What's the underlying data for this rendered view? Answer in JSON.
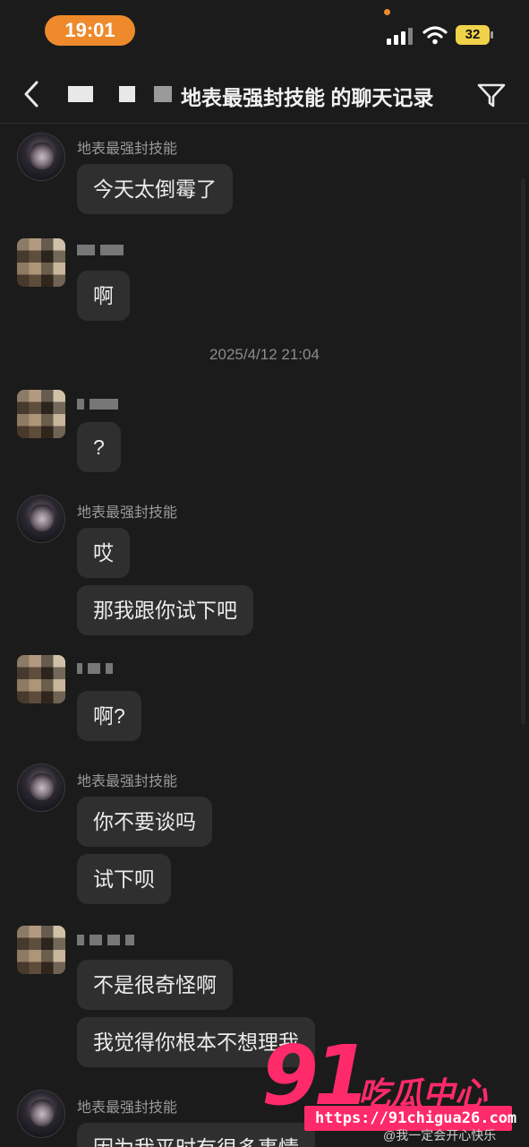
{
  "status_bar": {
    "time": "19:01",
    "battery": "32"
  },
  "header": {
    "title": "地表最强封技能 的聊天记录"
  },
  "contact_self_name": "地表最强封技能",
  "messages": {
    "m1": "今天太倒霉了",
    "m2": "啊",
    "timestamp": "2025/4/12 21:04",
    "m3": "?",
    "m4": "哎",
    "m5": "那我跟你试下吧",
    "m6": "啊?",
    "m7": "你不要谈吗",
    "m8": "试下呗",
    "m9": "不是很奇怪啊",
    "m10": "我觉得你根本不想理我",
    "m11": "因为我平时有很多事情"
  },
  "watermark": {
    "number": "91",
    "brand": "吃瓜中心",
    "url": "https://91chigua26.com",
    "weibo": "@我一定会开心快乐"
  },
  "colors": {
    "accent": "#ee8a2c",
    "watermark": "#ff2a6a",
    "bubble": "#2f2f2f",
    "background": "#1b1b1b"
  }
}
